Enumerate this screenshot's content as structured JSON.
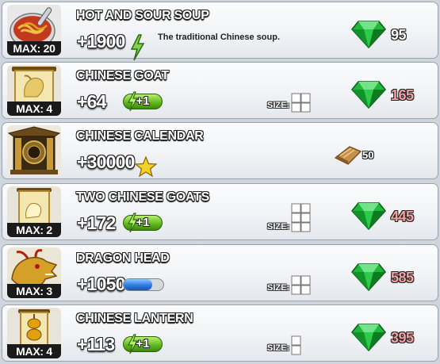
{
  "items": [
    {
      "name": "HOT AND SOUR SOUP",
      "max_label": "MAX: 20",
      "stat": "+1900",
      "stat_icon": "energy-bolt-icon",
      "description": "The traditional Chinese soup.",
      "price": "95",
      "price_icon": "emerald-gem-icon",
      "price_color": "#ffffff"
    },
    {
      "name": "CHINESE GOAT",
      "max_label": "MAX: 4",
      "stat": "+64",
      "badge": "+1",
      "size_label": "SIZE:",
      "size_grid": "2x2",
      "price": "165",
      "price_icon": "emerald-gem-icon",
      "price_color": "#f4a0a0"
    },
    {
      "name": "CHINESE CALENDAR",
      "stat": "+30000",
      "stat_icon": "star-icon",
      "price": "50",
      "price_icon": "bread-icon"
    },
    {
      "name": "TWO CHINESE GOATS",
      "max_label": "MAX: 2",
      "stat": "+172",
      "badge": "+1",
      "size_label": "SIZE:",
      "size_grid": "2x3",
      "price": "445",
      "price_icon": "emerald-gem-icon",
      "price_color": "#f4a0a0"
    },
    {
      "name": "DRAGON HEAD",
      "max_label": "MAX: 3",
      "stat": "+1050",
      "stat_icon": "blue-progress-pill",
      "size_label": "SIZE:",
      "size_grid": "2x2",
      "price": "585",
      "price_icon": "emerald-gem-icon",
      "price_color": "#f4a0a0"
    },
    {
      "name": "CHINESE LANTERN",
      "max_label": "MAX: 4",
      "stat": "+113",
      "badge": "+1",
      "size_label": "SIZE:",
      "size_grid": "1x2",
      "price": "395",
      "price_icon": "emerald-gem-icon",
      "price_color": "#f4a0a0"
    }
  ],
  "colors": {
    "gem_green": "#1fb83a",
    "badge_green": "#5fb51c",
    "price_red": "#f4a0a0"
  }
}
